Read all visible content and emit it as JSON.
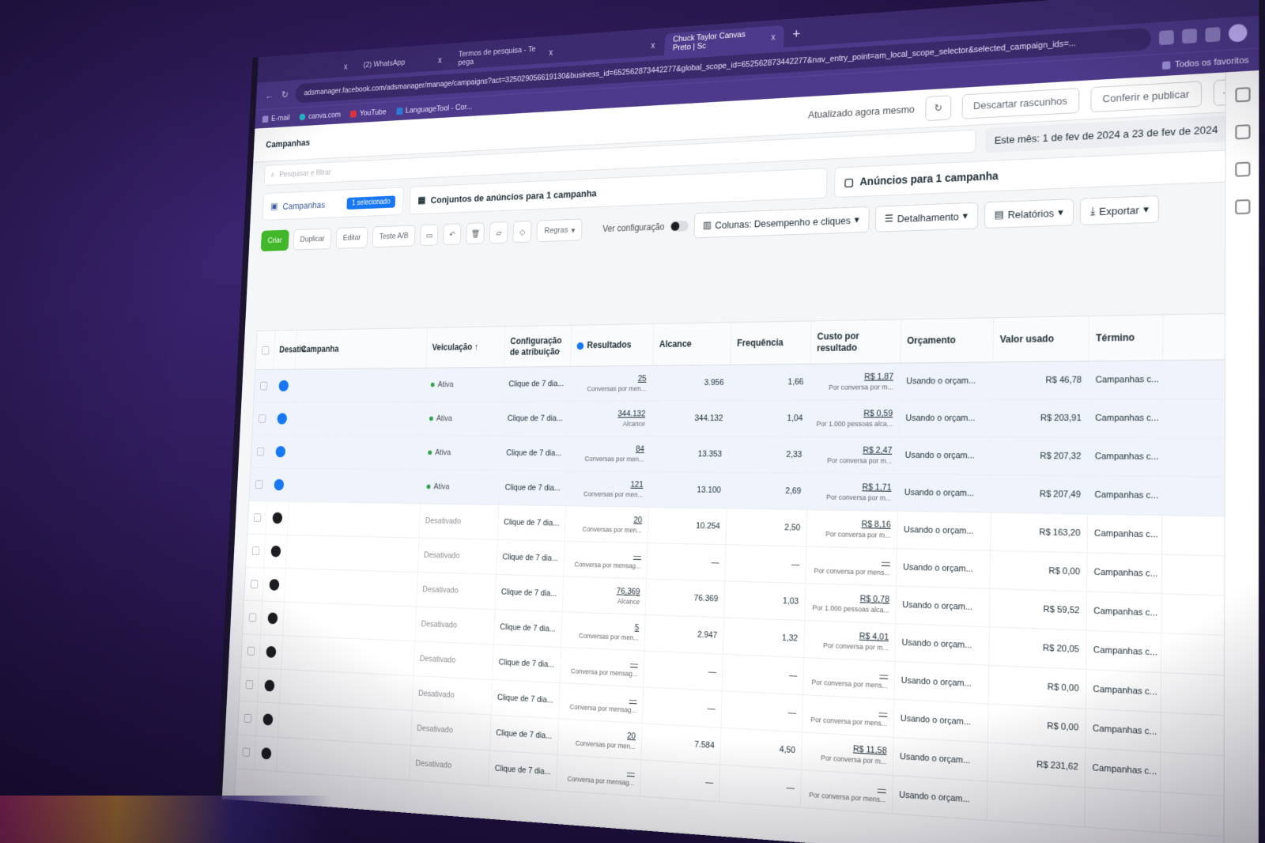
{
  "browser": {
    "tabs": [
      {
        "label": "",
        "active": false
      },
      {
        "label": "(2) WhatsApp",
        "active": false
      },
      {
        "label": "Termos de pesquisa - Te pega",
        "active": false
      },
      {
        "label": "",
        "active": false
      },
      {
        "label": "Chuck Taylor Canvas Preto | Sc",
        "active": true
      }
    ],
    "new_tab": "+",
    "close": "x",
    "url": "adsmanager.facebook.com/adsmanager/manage/campaigns?act=325029056619130&business_id=652562873442277&global_scope_id=652562873442277&nav_entry_point=am_local_scope_selector&selected_campaign_ids=...",
    "bookmarks": [
      "E-mail",
      "canva.com",
      "YouTube",
      "LanguageTool - Cor..."
    ],
    "bookmarks_right": "Todos os favoritos"
  },
  "app": {
    "crumb": "Campanhas",
    "updated": "Atualizado agora mesmo",
    "discard": "Descartar rascunhos",
    "publish": "Conferir e publicar",
    "more": "···",
    "search_placeholder": "Pesquisar e filtrar",
    "date_range": "Este mês: 1 de fev de 2024 a 23 de fev de 2024",
    "tabs": {
      "campaigns": "Campanhas",
      "selected": "1 selecionado",
      "adsets": "Conjuntos de anúncios para 1 campanha",
      "ads": "Anúncios para 1 campanha"
    },
    "toolbar": {
      "create": "Criar",
      "duplicate": "Duplicar",
      "edit": "Editar",
      "ab_test": "Teste A/B",
      "rules": "Regras",
      "view_setup": "Ver configuração",
      "columns": "Colunas: Desempenho e cliques",
      "breakdown": "Detalhamento",
      "reports": "Relatórios",
      "export": "Exportar"
    }
  },
  "table": {
    "headers": {
      "toggle": "Desativ.",
      "campaign": "Campanha",
      "delivery": "Veiculação ↑",
      "attribution": "Configuração de atribuição",
      "results": "Resultados",
      "reach": "Alcance",
      "frequency": "Frequência",
      "cpr": "Custo por resultado",
      "budget": "Orçamento",
      "spent": "Valor usado",
      "end": "Término"
    },
    "rows": [
      {
        "on": true,
        "delivery": "Ativa",
        "attr": "Clique de 7 dia...",
        "res": "25",
        "res_sub": "Conversas por men...",
        "reach": "3.956",
        "freq": "1,66",
        "cpr": "R$ 1,87",
        "cpr_sub": "Por conversa por m...",
        "budget": "Usando o orçam...",
        "spent": "R$ 46,78",
        "end": "Campanhas c..."
      },
      {
        "on": true,
        "delivery": "Ativa",
        "attr": "Clique de 7 dia...",
        "res": "344.132",
        "res_sub": "Alcance",
        "reach": "344.132",
        "freq": "1,04",
        "cpr": "R$ 0,59",
        "cpr_sub": "Por 1.000 pessoas alca...",
        "budget": "Usando o orçam...",
        "spent": "R$ 203,91",
        "end": "Campanhas c..."
      },
      {
        "on": true,
        "delivery": "Ativa",
        "attr": "Clique de 7 dia...",
        "res": "84",
        "res_sub": "Conversas por men...",
        "reach": "13.353",
        "freq": "2,33",
        "cpr": "R$ 2,47",
        "cpr_sub": "Por conversa por m...",
        "budget": "Usando o orçam...",
        "spent": "R$ 207,32",
        "end": "Campanhas c..."
      },
      {
        "on": true,
        "delivery": "Ativa",
        "attr": "Clique de 7 dia...",
        "res": "121",
        "res_sub": "Conversas por men...",
        "reach": "13.100",
        "freq": "2,69",
        "cpr": "R$ 1,71",
        "cpr_sub": "Por conversa por m...",
        "budget": "Usando o orçam...",
        "spent": "R$ 207,49",
        "end": "Campanhas c..."
      },
      {
        "on": false,
        "delivery": "Desativado",
        "attr": "Clique de 7 dia...",
        "res": "20",
        "res_sub": "Conversas por men...",
        "reach": "10.254",
        "freq": "2,50",
        "cpr": "R$ 8,16",
        "cpr_sub": "Por conversa por m...",
        "budget": "Usando o orçam...",
        "spent": "R$ 163,20",
        "end": "Campanhas c..."
      },
      {
        "on": false,
        "delivery": "Desativado",
        "attr": "Clique de 7 dia...",
        "res": "—",
        "res_sub": "Conversa por mensag...",
        "reach": "—",
        "freq": "—",
        "cpr": "—",
        "cpr_sub": "Por conversa por mens...",
        "budget": "Usando o orçam...",
        "spent": "R$ 0,00",
        "end": "Campanhas c..."
      },
      {
        "on": false,
        "delivery": "Desativado",
        "attr": "Clique de 7 dia...",
        "res": "76.369",
        "res_sub": "Alcance",
        "reach": "76.369",
        "freq": "1,03",
        "cpr": "R$ 0,78",
        "cpr_sub": "Por 1.000 pessoas alca...",
        "budget": "Usando o orçam...",
        "spent": "R$ 59,52",
        "end": "Campanhas c..."
      },
      {
        "on": false,
        "delivery": "Desativado",
        "attr": "Clique de 7 dia...",
        "res": "5",
        "res_sub": "Conversas por men...",
        "reach": "2.947",
        "freq": "1,32",
        "cpr": "R$ 4,01",
        "cpr_sub": "Por conversa por m...",
        "budget": "Usando o orçam...",
        "spent": "R$ 20,05",
        "end": "Campanhas c..."
      },
      {
        "on": false,
        "delivery": "Desativado",
        "attr": "Clique de 7 dia...",
        "res": "—",
        "res_sub": "Conversa por mensag...",
        "reach": "—",
        "freq": "—",
        "cpr": "—",
        "cpr_sub": "Por conversa por mens...",
        "budget": "Usando o orçam...",
        "spent": "R$ 0,00",
        "end": "Campanhas c..."
      },
      {
        "on": false,
        "delivery": "Desativado",
        "attr": "Clique de 7 dia...",
        "res": "—",
        "res_sub": "Conversa por mensag...",
        "reach": "—",
        "freq": "—",
        "cpr": "—",
        "cpr_sub": "Por conversa por mens...",
        "budget": "Usando o orçam...",
        "spent": "R$ 0,00",
        "end": "Campanhas c..."
      },
      {
        "on": false,
        "delivery": "Desativado",
        "attr": "Clique de 7 dia...",
        "res": "20",
        "res_sub": "Conversas por men...",
        "reach": "7.584",
        "freq": "4,50",
        "cpr": "R$ 11,58",
        "cpr_sub": "Por conversa por m...",
        "budget": "Usando o orçam...",
        "spent": "R$ 231,62",
        "end": "Campanhas c..."
      },
      {
        "on": false,
        "delivery": "Desativado",
        "attr": "Clique de 7 dia...",
        "res": "—",
        "res_sub": "Conversa por mensag...",
        "reach": "—",
        "freq": "—",
        "cpr": "—",
        "cpr_sub": "Por conversa por mens...",
        "budget": "Usando o orçam...",
        "spent": "",
        "end": ""
      }
    ]
  }
}
